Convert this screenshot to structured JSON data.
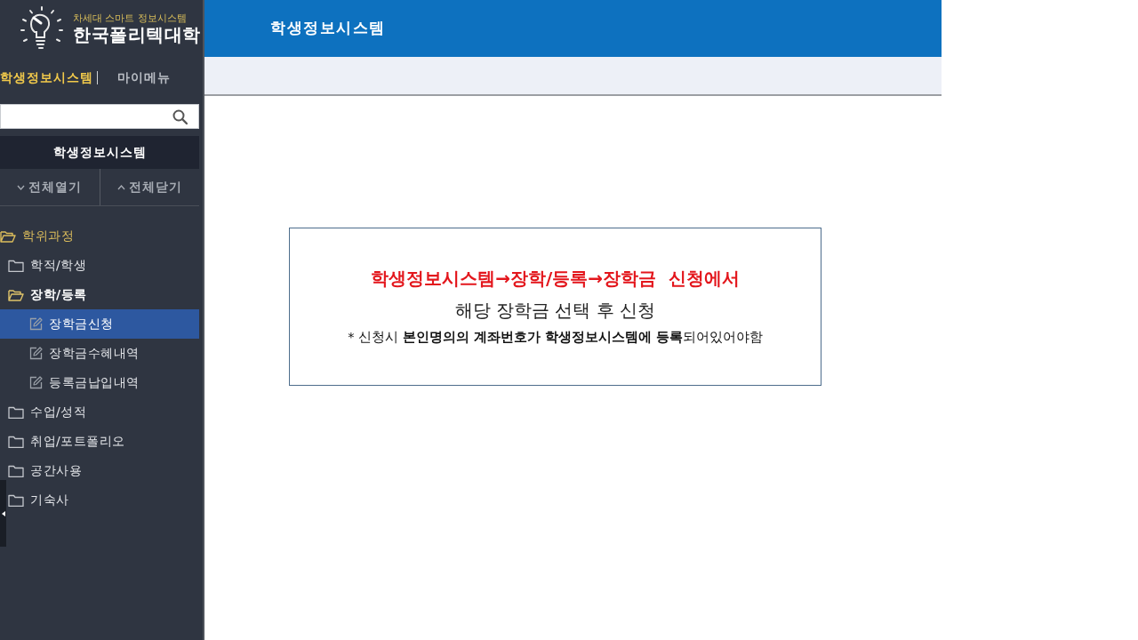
{
  "sidebar": {
    "logo": {
      "tagline": "차세대 스마트 정보시스템",
      "name": "한국폴리텍대학"
    },
    "tabs": [
      {
        "label": "학생정보시스템",
        "selected": true
      },
      {
        "label": "마이메뉴",
        "selected": false
      }
    ],
    "menu_title": "학생정보시스템",
    "buttons": [
      {
        "label": "전체열기",
        "kind": "expand"
      },
      {
        "label": "전체닫기",
        "kind": "collapse"
      }
    ],
    "tree": [
      {
        "label": "학위과정",
        "kind": "folder",
        "expanded": true,
        "selected": false,
        "children": [
          {
            "label": "학적/학생",
            "kind": "folder",
            "expanded": false,
            "selected": false
          },
          {
            "label": "장학/등록",
            "kind": "folder",
            "expanded": true,
            "selected": false,
            "children": [
              {
                "label": "장학금신청",
                "kind": "page",
                "selected": true
              },
              {
                "label": "장학금수혜내역",
                "kind": "page",
                "selected": false
              },
              {
                "label": "등록금납입내역",
                "kind": "page",
                "selected": false
              }
            ]
          },
          {
            "label": "수업/성적",
            "kind": "folder",
            "expanded": false,
            "selected": false
          },
          {
            "label": "취업/포트폴리오",
            "kind": "folder",
            "expanded": false,
            "selected": false
          },
          {
            "label": "공간사용",
            "kind": "folder",
            "expanded": false,
            "selected": false
          },
          {
            "label": "기숙사",
            "kind": "folder",
            "expanded": false,
            "selected": false
          }
        ]
      }
    ]
  },
  "header": {
    "title": "학생정보시스템"
  },
  "notice": {
    "lines": [
      {
        "kind": "highlight",
        "text": "학생정보시스템→장학/등록→장학금  신청에서"
      },
      {
        "kind": "main",
        "text": "해당 장학금 선택 후 신청"
      },
      {
        "kind": "note",
        "text": "* 신청시 **본인명의의 계좌번호가 학생정보시스템에 등록**되어있어야함"
      }
    ]
  }
}
